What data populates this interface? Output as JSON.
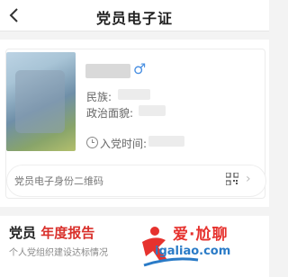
{
  "header": {
    "title": "党员电子证"
  },
  "profile": {
    "gender_symbol": "♂",
    "ethnicity_label": "民族:",
    "political_label": "政治面貌:",
    "join_date_label": "入党时间:"
  },
  "qr_row": {
    "label": "党员电子身份二维码",
    "chevron": "›"
  },
  "report": {
    "title_prefix": "党员",
    "title_highlight": "年度报告",
    "subtitle": "个人党组织建设达标情况"
  },
  "watermark": {
    "text": "爱·尬聊",
    "url": "igaliao.com"
  },
  "colors": {
    "accent_red": "#d9302b",
    "male_blue": "#4a90e2"
  }
}
